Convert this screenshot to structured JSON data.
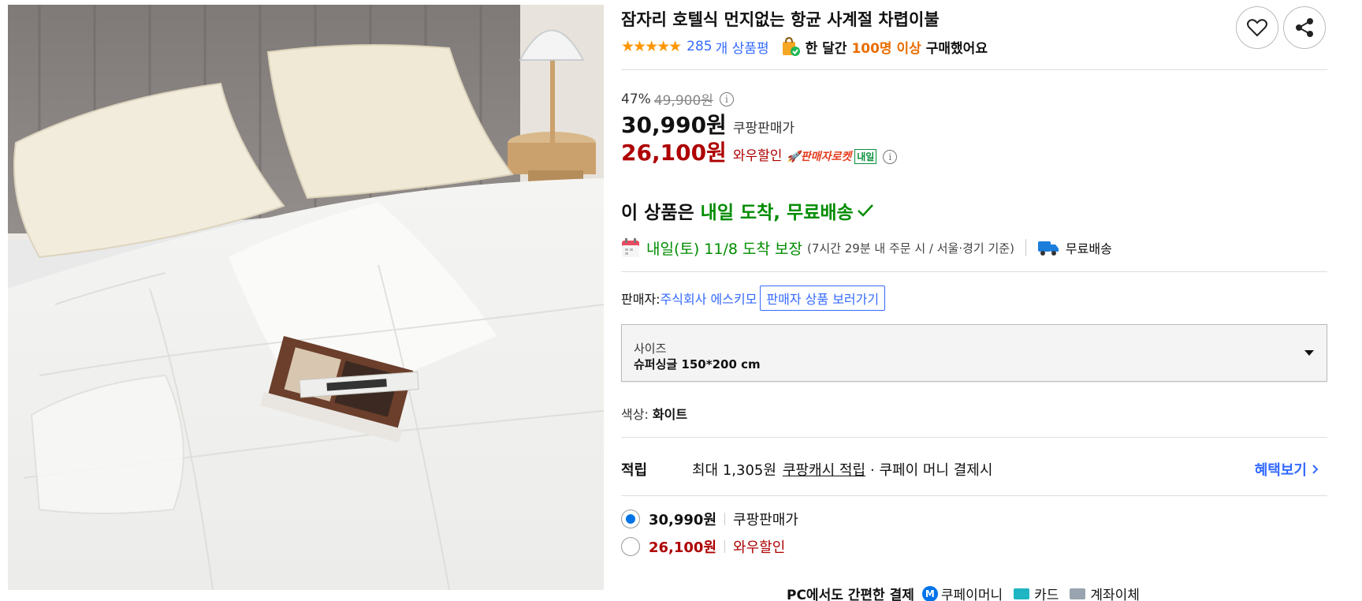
{
  "product": {
    "title": "잠자리 호텔식 먼지없는 항균 사계절 차렵이불"
  },
  "actions": {
    "wishlist_icon": "heart-icon",
    "share_icon": "share-icon"
  },
  "rating": {
    "stars": "★★★★★",
    "review_count": "285",
    "review_label": "개 상품평"
  },
  "purchase_stat": {
    "prefix": "한 달간",
    "highlight": "100명 이상",
    "suffix": "구매했어요"
  },
  "pricing": {
    "discount_rate": "47%",
    "original_price": "49,900원",
    "sale_price": "30,990원",
    "sale_label": "쿠팡판매가",
    "wow_price": "26,100원",
    "wow_label": "와우할인",
    "rocket_label": "🚀판매자로켓",
    "tomorrow_badge": "내일"
  },
  "arrival": {
    "prefix": "이 상품은",
    "highlight": "내일 도착, 무료배송"
  },
  "delivery": {
    "date": "내일(토) 11/8 도착 보장",
    "condition": "(7시간 29분 내 주문 시 / 서울·경기 기준)",
    "shipping": "무료배송"
  },
  "seller": {
    "label": "판매자: ",
    "name": "주식회사 에스키모",
    "button": "판매자 상품 보러가기"
  },
  "size": {
    "label": "사이즈",
    "value": "슈퍼싱글 150*200 cm"
  },
  "color": {
    "label": "색상: ",
    "value": "화이트"
  },
  "points": {
    "title": "적립",
    "desc": "최대 1,305원",
    "cash": "쿠팡캐시 적립",
    "tail": "· 쿠페이 머니 결제시",
    "more": "혜택보기"
  },
  "options": [
    {
      "price": "30,990원",
      "label": "쿠팡판매가",
      "selected": true
    },
    {
      "price": "26,100원",
      "label": "와우할인",
      "selected": false
    }
  ],
  "payment": {
    "title": "PC에서도 간편한 결제",
    "methods": [
      "쿠페이머니",
      "카드",
      "계좌이체"
    ],
    "m_badge": "M"
  },
  "colors": {
    "link_blue": "#346aff",
    "wow_red": "#ae0000",
    "green": "#008c00",
    "orange": "#e96d00",
    "star": "#ff9600"
  }
}
